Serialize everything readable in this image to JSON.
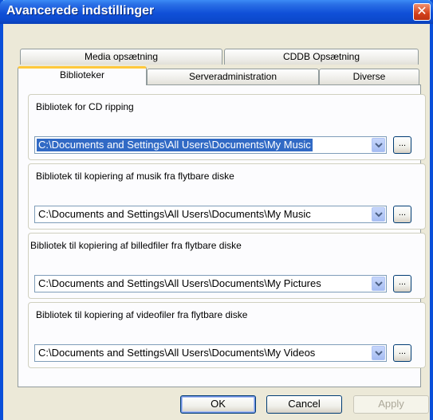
{
  "window": {
    "title": "Avancerede indstillinger",
    "close_glyph": "✕"
  },
  "tabs": {
    "row_back": [
      {
        "label": "Media opsætning"
      },
      {
        "label": "CDDB Opsætning"
      }
    ],
    "row_front": [
      {
        "label": "Biblioteker",
        "active": true
      },
      {
        "label": "Serveradministration"
      },
      {
        "label": "Diverse"
      }
    ]
  },
  "groups": [
    {
      "label": "Bibliotek for CD ripping",
      "value": "C:\\Documents and Settings\\All Users\\Documents\\My Music",
      "selected": true
    },
    {
      "label": "Bibliotek til kopiering af musik fra flytbare diske",
      "value": "C:\\Documents and Settings\\All Users\\Documents\\My Music",
      "selected": false
    },
    {
      "label": "Bibliotek til kopiering af billedfiler fra flytbare diske",
      "value": "C:\\Documents and Settings\\All Users\\Documents\\My Pictures",
      "selected": false
    },
    {
      "label": "Bibliotek til kopiering af videofiler fra flytbare diske",
      "value": "C:\\Documents and Settings\\All Users\\Documents\\My Videos",
      "selected": false
    }
  ],
  "browse_label": "...",
  "buttons": {
    "ok": "OK",
    "cancel": "Cancel",
    "apply": "Apply"
  },
  "colors": {
    "title_blue": "#0A4FD9",
    "selection": "#316AC5",
    "tab_highlight": "#FFC83C"
  },
  "icons": {
    "dropdown": "chevron-down-icon",
    "close": "close-icon"
  }
}
